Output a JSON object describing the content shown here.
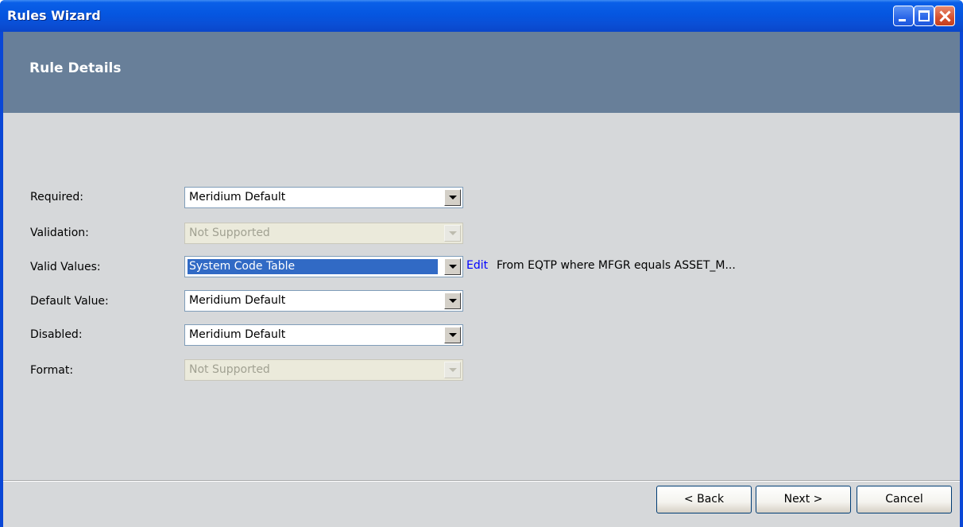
{
  "window": {
    "title": "Rules Wizard",
    "buttons": {
      "minimize": "minimize-icon",
      "maximize": "maximize-icon",
      "close": "close-icon"
    }
  },
  "header": {
    "title": "Rule Details"
  },
  "fields": {
    "required": {
      "label": "Required:",
      "value": "Meridium Default",
      "enabled": true
    },
    "validation": {
      "label": "Validation:",
      "value": "Not Supported",
      "enabled": false
    },
    "valid_values": {
      "label": "Valid Values:",
      "value": "System Code Table",
      "enabled": true,
      "selected": true,
      "edit_link": "Edit",
      "description": "From EQTP where MFGR equals ASSET_M..."
    },
    "default_value": {
      "label": "Default Value:",
      "value": "Meridium Default",
      "enabled": true
    },
    "disabled": {
      "label": "Disabled:",
      "value": "Meridium Default",
      "enabled": true
    },
    "format": {
      "label": "Format:",
      "value": "Not Supported",
      "enabled": false
    }
  },
  "footer": {
    "back": "< Back",
    "next": "Next >",
    "cancel": "Cancel"
  },
  "colors": {
    "titlebar": "#0a4fd6",
    "header_band": "#687f99",
    "content_bg": "#d6d8da",
    "selection": "#316ac5",
    "link": "#0000ff"
  }
}
